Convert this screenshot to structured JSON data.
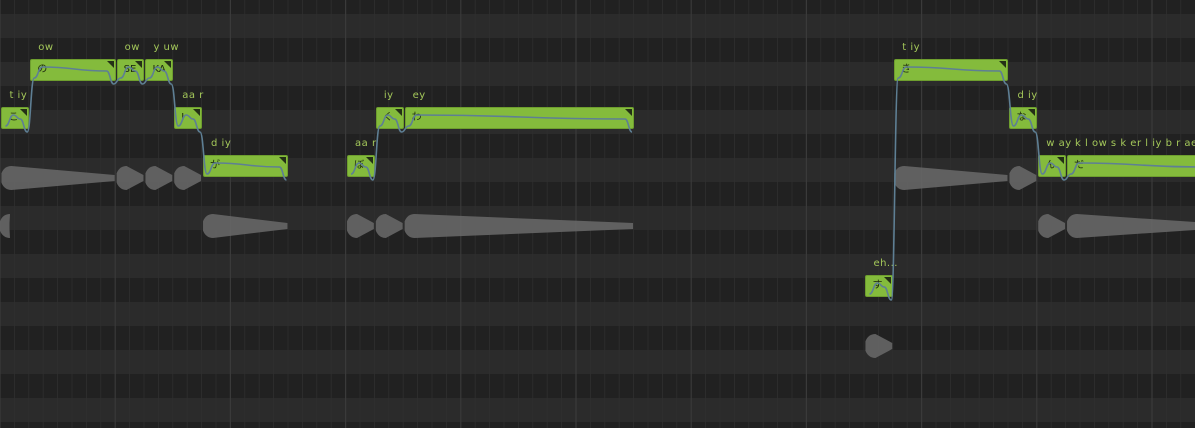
{
  "piano_roll": {
    "notes": [
      {
        "lyric": "",
        "phoneme": "",
        "col": 0,
        "span": 0.1,
        "row": 7
      },
      {
        "lyric": "こ",
        "phoneme": "t iy",
        "col": 0.05,
        "span": 1,
        "row": 5
      },
      {
        "lyric": "の",
        "phoneme": "ow",
        "col": 1.05,
        "span": 3,
        "row": 3
      },
      {
        "lyric": "SE",
        "phoneme": "ow",
        "col": 4.05,
        "span": 1,
        "row": 3
      },
      {
        "lyric": "KA",
        "phoneme": "y uw",
        "col": 5.05,
        "span": 1,
        "row": 3
      },
      {
        "lyric": "I",
        "phoneme": "aa r",
        "col": 6.05,
        "span": 1,
        "row": 5
      },
      {
        "lyric": "が",
        "phoneme": "d iy",
        "col": 7.05,
        "span": 3,
        "row": 7
      },
      {
        "lyric": "ぼ",
        "phoneme": "aa r",
        "col": 12.05,
        "span": 1,
        "row": 7
      },
      {
        "lyric": "く",
        "phoneme": "iy",
        "col": 13.05,
        "span": 1,
        "row": 5
      },
      {
        "lyric": "わ",
        "phoneme": "ey",
        "col": 14.05,
        "span": 8,
        "row": 5
      },
      {
        "lyric": "す",
        "phoneme": "eh...",
        "col": 30.05,
        "span": 1,
        "row": 12
      },
      {
        "lyric": "き",
        "phoneme": "t iy",
        "col": 31.05,
        "span": 4,
        "row": 3
      },
      {
        "lyric": "な",
        "phoneme": "d iy",
        "col": 35.05,
        "span": 1,
        "row": 5
      },
      {
        "lyric": "ん",
        "phoneme": "w ay",
        "col": 36.05,
        "span": 1,
        "row": 7
      },
      {
        "lyric": "だ",
        "phoneme": "k l ow s k er l iy b r ae k ih",
        "col": 37.05,
        "span": 5,
        "row": 7
      }
    ],
    "waveform_segments": [
      {
        "col": 0.05,
        "span": 4,
        "row": 7
      },
      {
        "col": 4.05,
        "span": 1,
        "row": 7
      },
      {
        "col": 5.05,
        "span": 1,
        "row": 7
      },
      {
        "col": 6.05,
        "span": 1,
        "row": 7
      },
      {
        "col": 0.0,
        "span": 0.4,
        "row": 9
      },
      {
        "col": 7.05,
        "span": 3,
        "row": 9
      },
      {
        "col": 12.05,
        "span": 1,
        "row": 9
      },
      {
        "col": 13.05,
        "span": 1,
        "row": 9
      },
      {
        "col": 14.05,
        "span": 8,
        "row": 9
      },
      {
        "col": 31.05,
        "span": 4,
        "row": 7
      },
      {
        "col": 35.05,
        "span": 1,
        "row": 7
      },
      {
        "col": 36.05,
        "span": 1,
        "row": 9
      },
      {
        "col": 37.05,
        "span": 5,
        "row": 9
      },
      {
        "col": 30.05,
        "span": 1,
        "row": 14
      }
    ],
    "colors": {
      "background": "#262626",
      "row_dark": "#212121",
      "row_light": "#2b2b2b",
      "note_fill": "#84bb3c",
      "phoneme_text": "#a4c85a",
      "pitch_curve": "#5e7f94",
      "waveform": "#6a6a6a"
    }
  }
}
